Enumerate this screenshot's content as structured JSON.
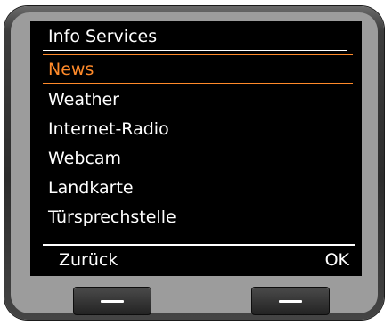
{
  "screen": {
    "title": "Info Services",
    "menu": [
      {
        "label": "News",
        "selected": true
      },
      {
        "label": "Weather"
      },
      {
        "label": "Internet-Radio"
      },
      {
        "label": "Webcam"
      },
      {
        "label": "Landkarte"
      },
      {
        "label": "Türsprechstelle"
      }
    ],
    "softkeys": {
      "left": "Zurück",
      "right": "OK"
    }
  },
  "colors": {
    "screen_background": "#000000",
    "text": "#ffffff",
    "selection_accent": "#ff8a2a",
    "device_body": "#2c2c2c",
    "device_panel": "#9c9c9c"
  },
  "icons": {
    "hardware_button_left": "minus-icon",
    "hardware_button_right": "minus-icon"
  }
}
